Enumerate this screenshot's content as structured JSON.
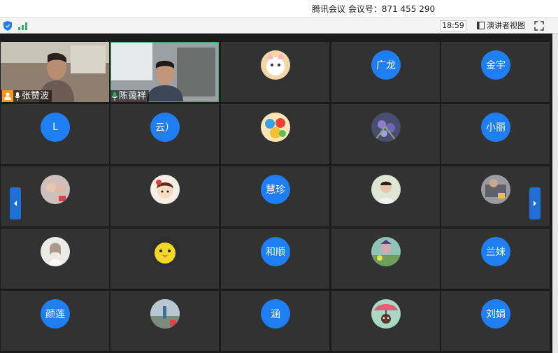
{
  "window": {
    "title": "腾讯会议 会议号：871 455 290"
  },
  "toolbar": {
    "security_icon": "shield-icon",
    "signal_icon": "signal-icon",
    "elapsed_time": "18:59",
    "view_label": "演讲者视图",
    "view_icon": "speaker-view-icon",
    "fullscreen_icon": "fullscreen-icon"
  },
  "colors": {
    "accent": "#1e7ef2",
    "active_speaker_border": "#2fb56a",
    "host_badge": "#f39a1e",
    "tile_bg": "#323232"
  },
  "participants": [
    {
      "name": "张赞波",
      "type": "video",
      "host": true,
      "mic": true
    },
    {
      "name": "陈蔼祥",
      "type": "video",
      "active": true,
      "mic": true
    },
    {
      "avatar": "cartoon-avatar",
      "type": "image"
    },
    {
      "initials": "广龙",
      "type": "initials"
    },
    {
      "initials": "金宇",
      "type": "initials"
    },
    {
      "initials": "L",
      "type": "initials"
    },
    {
      "initials": "云）",
      "type": "initials"
    },
    {
      "avatar": "cartoon-group-avatar",
      "type": "image"
    },
    {
      "avatar": "flower-avatar",
      "type": "image"
    },
    {
      "initials": "小丽",
      "type": "initials"
    },
    {
      "avatar": "photo-avatar",
      "type": "image"
    },
    {
      "avatar": "doll-avatar",
      "type": "image"
    },
    {
      "initials": "慧珍",
      "type": "initials"
    },
    {
      "avatar": "child-photo-avatar",
      "type": "image"
    },
    {
      "avatar": "photo-avatar",
      "type": "image"
    },
    {
      "avatar": "portrait-avatar",
      "type": "image"
    },
    {
      "avatar": "chick-avatar",
      "type": "image"
    },
    {
      "initials": "和顺",
      "type": "initials"
    },
    {
      "avatar": "cartoon-avatar",
      "type": "image"
    },
    {
      "initials": "兰妹",
      "type": "initials"
    },
    {
      "initials": "颜莲",
      "type": "initials"
    },
    {
      "avatar": "landscape-avatar",
      "type": "image"
    },
    {
      "initials": "涵",
      "type": "initials"
    },
    {
      "avatar": "umbrella-cartoon-avatar",
      "type": "image"
    },
    {
      "initials": "刘娟",
      "type": "initials"
    }
  ],
  "nav": {
    "prev_icon": "chevron-left-icon",
    "next_icon": "chevron-right-icon"
  }
}
